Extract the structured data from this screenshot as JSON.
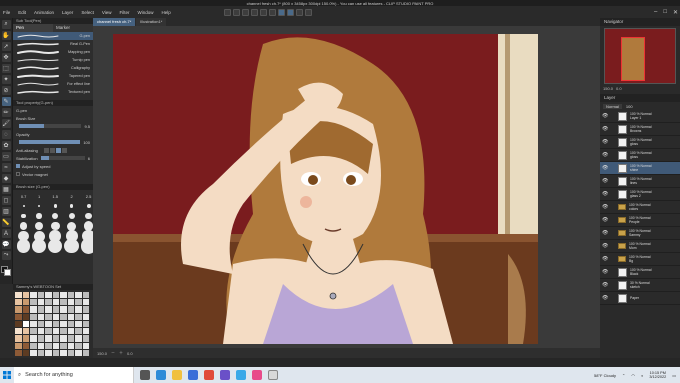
{
  "window": {
    "title": "channel fresh ch.7* (800 x 3458px 300dpi 150.0%)  - You can use all features - CLIP STUDIO PAINT PRO"
  },
  "menu": [
    "File",
    "Edit",
    "Animation",
    "Layer",
    "Select",
    "View",
    "Filter",
    "Window",
    "Help"
  ],
  "subtool": {
    "header": "Sub Tool(Pen)",
    "tabs": [
      "Pen",
      "Marker"
    ],
    "brushes": [
      "G-pen",
      "Real G-Pen",
      "Mapping pen",
      "Turnip pen",
      "Calligraphy",
      "Tapered pen",
      "For effect line",
      "Textured pen"
    ],
    "selected_index": 0
  },
  "tool_property": {
    "header": "Tool property(G-pen)",
    "brush_label": "G-pen",
    "brush_size_label": "Brush Size",
    "brush_size": "9.5",
    "opacity_label": "Opacity",
    "opacity": "100",
    "opacity_fraction": 1.0,
    "antialias_label": "Anti-aliasing",
    "stabilization_label": "Stabilization",
    "stabilization": "6",
    "adjust_label": "Adjust by speed",
    "vector_label": "Vector magnet"
  },
  "brush_size_panel": {
    "header": "Brush size (G-pen)",
    "sizes": [
      "0.7",
      "1",
      "1.5",
      "2",
      "2.5",
      "3"
    ]
  },
  "color_set": {
    "header": "Sammy's WEBTOON Set"
  },
  "canvas": {
    "tabs": [
      "channel fresh ch.7*",
      "Illustration1*"
    ],
    "zoom": "150.0",
    "angle": "0.0"
  },
  "navigator": {
    "header": "Navigator",
    "zoom": "150.0",
    "angle": "0.0"
  },
  "layers": {
    "header": "Layer",
    "blend": "Normal",
    "opacity": "100",
    "items": [
      {
        "name": "100 % Normal",
        "sub": "Layer 1",
        "type": "layer"
      },
      {
        "name": "100 % Normal",
        "sub": "Browns",
        "type": "layer"
      },
      {
        "name": "100 % Normal",
        "sub": "gloss",
        "type": "layer"
      },
      {
        "name": "100 % Normal",
        "sub": "gloss",
        "type": "layer"
      },
      {
        "name": "100 % Normal",
        "sub": "shine",
        "type": "layer",
        "selected": true
      },
      {
        "name": "100 % Normal",
        "sub": "lines",
        "type": "layer"
      },
      {
        "name": "100 % Normal",
        "sub": "glass 2",
        "type": "layer"
      },
      {
        "name": "100 % Normal",
        "sub": "colors",
        "type": "folder"
      },
      {
        "name": "100 % Normal",
        "sub": "People",
        "type": "folder"
      },
      {
        "name": "100 % Normal",
        "sub": "Sammy",
        "type": "folder"
      },
      {
        "name": "100 % Normal",
        "sub": "Mom",
        "type": "folder"
      },
      {
        "name": "100 % Normal",
        "sub": "Bg",
        "type": "folder"
      },
      {
        "name": "100 % Normal",
        "sub": "Black",
        "type": "layer"
      },
      {
        "name": "30 % Normal",
        "sub": "sketch",
        "type": "layer"
      },
      {
        "name": "",
        "sub": "Paper",
        "type": "paper"
      }
    ]
  },
  "taskbar": {
    "search_placeholder": "Search for anything",
    "weather": "58°F Cloudy",
    "time": "10:15 PM",
    "date": "3/12/2022"
  },
  "colors": {
    "accent": "#405a78",
    "wall": "#7a1c1e",
    "hair": "#b07a3c",
    "skin": "#f4dcc4",
    "shirt": "#b9a6d6",
    "desk": "#6b3a1e"
  }
}
